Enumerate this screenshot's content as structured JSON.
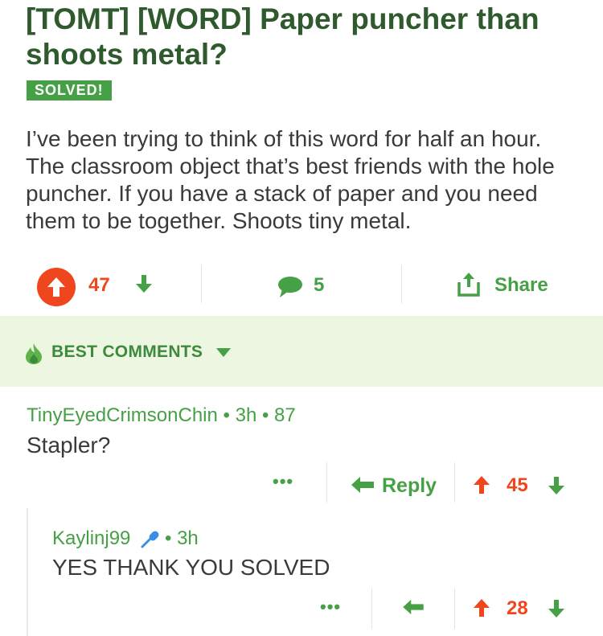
{
  "post": {
    "title": "[TOMT] [WORD] Paper puncher than shoots metal?",
    "badge": "SOLVED!",
    "body": "I’ve been trying to think of this word for half an hour. The classroom object that’s best friends with the hole puncher. If you have a stack of paper and you need them to be together. Shoots tiny metal.",
    "score": "47",
    "comment_count": "5",
    "share_label": "Share"
  },
  "sort": {
    "label": "BEST COMMENTS"
  },
  "comments": [
    {
      "meta": "TinyEyedCrimsonChin • 3h • 87",
      "text": "Stapler?",
      "more": "•••",
      "reply_label": "Reply",
      "score": "45"
    },
    {
      "author": "Kaylinj99",
      "time": "• 3h",
      "text": "YES THANK YOU SOLVED",
      "more": "•••",
      "score": "28"
    }
  ],
  "colors": {
    "green": "#46a046",
    "dark_green": "#2e5a2e",
    "orange": "#f0461e",
    "banner_bg": "#ecf6e1"
  },
  "icons": [
    "upvote-icon",
    "downvote-icon",
    "comment-icon",
    "share-icon",
    "flame-icon",
    "caret-down-icon",
    "reply-icon",
    "microphone-icon"
  ]
}
